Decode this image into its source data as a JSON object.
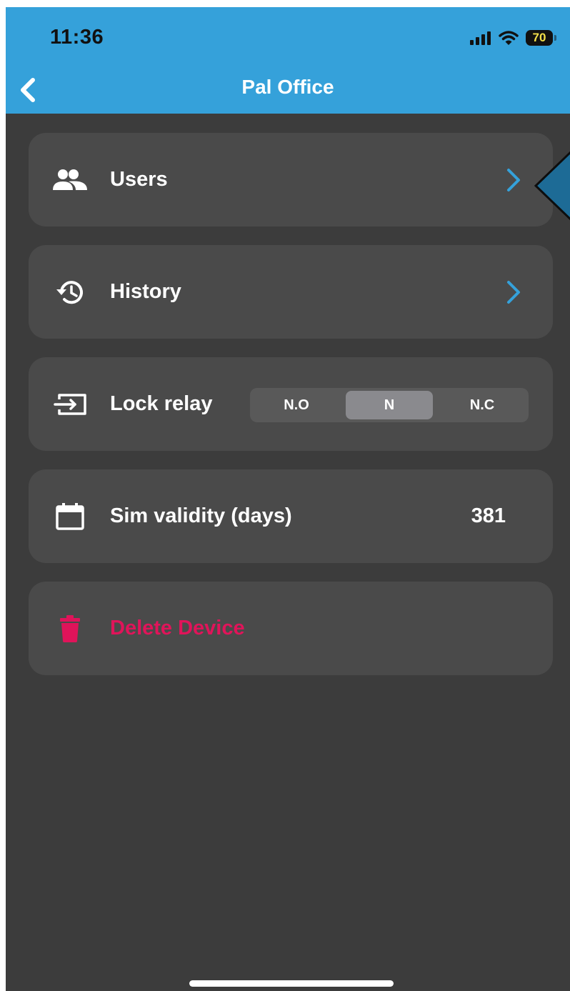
{
  "status_bar": {
    "time": "11:36",
    "battery": "70",
    "icons": [
      "signal-icon",
      "wifi-icon",
      "battery-icon"
    ]
  },
  "header": {
    "title": "Pal Office",
    "back_icon": "chevron-left-icon"
  },
  "menu": {
    "users": {
      "label": "Users",
      "icon": "people-icon"
    },
    "history": {
      "label": "History",
      "icon": "history-icon"
    },
    "lock_relay": {
      "label": "Lock relay",
      "icon": "input-icon",
      "options": [
        "N.O",
        "N",
        "N.C"
      ],
      "selected": "N"
    },
    "sim_validity": {
      "label": "Sim validity (days)",
      "icon": "calendar-icon",
      "value": "381"
    },
    "delete": {
      "label": "Delete Device",
      "icon": "trash-icon"
    }
  },
  "colors": {
    "header_bg": "#35a1da",
    "screen_bg": "#3c3c3c",
    "card_bg": "#4a4a4a",
    "chevron": "#35a1da",
    "danger": "#e0145a",
    "segment_active": "#8a8a8e"
  }
}
